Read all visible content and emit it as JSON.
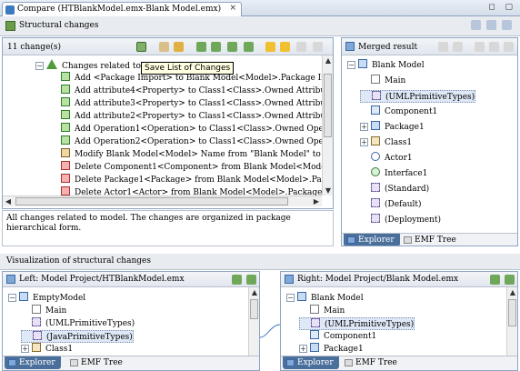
{
  "editor": {
    "tab_title": "Compare (HTBlankModel.emx-Blank Model.emx)",
    "close_glyph": "×",
    "window_glyphs": "◻ ▢"
  },
  "structural": {
    "section_title": "Structural changes",
    "count_label": "11 change(s)",
    "tooltip": "Save List of Changes",
    "rows": [
      {
        "text": "Changes related to Blank Model",
        "kind": "tri",
        "expand": "−"
      },
      {
        "text": "Add <Package Import> to Blank Model<Model>.Package Import",
        "kind": "add"
      },
      {
        "text": "Add attribute4<Property> to Class1<Class>.Owned Attribute",
        "kind": "add"
      },
      {
        "text": "Add attribute3<Property> to Class1<Class>.Owned Attribute",
        "kind": "add"
      },
      {
        "text": "Add attribute2<Property> to Class1<Class>.Owned Attribute",
        "kind": "add"
      },
      {
        "text": "Add Operation1<Operation> to Class1<Class>.Owned Operation",
        "kind": "add"
      },
      {
        "text": "Add Operation2<Operation> to Class1<Class>.Owned Operation",
        "kind": "add"
      },
      {
        "text": "Modify Blank Model<Model> Name from \"Blank Model\" to \"Em",
        "kind": "mod"
      },
      {
        "text": "Delete Component1<Component> from Blank Model<Model>.Pa",
        "kind": "del"
      },
      {
        "text": "Delete Package1<Package> from Blank Model<Model>.Packagec",
        "kind": "del"
      },
      {
        "text": "Delete Actor1<Actor> from Blank Model<Model>.Packaged Ele",
        "kind": "del"
      }
    ],
    "description": "All changes related to model. The changes are organized in package hierarchical form."
  },
  "merged": {
    "title": "Merged result",
    "tree": [
      {
        "text": "Blank Model",
        "kind": "pkg",
        "expand": "−",
        "indent": 0
      },
      {
        "text": "Main",
        "kind": "doc",
        "indent": 1
      },
      {
        "text": "(UMLPrimitiveTypes)",
        "kind": "lib",
        "indent": 1,
        "selected": true
      },
      {
        "text": "Component1",
        "kind": "comp",
        "indent": 1
      },
      {
        "text": "Package1",
        "kind": "pkg",
        "expand": "+",
        "indent": 1
      },
      {
        "text": "Class1",
        "kind": "cls",
        "expand": "+",
        "indent": 1
      },
      {
        "text": "Actor1",
        "kind": "actor",
        "indent": 1
      },
      {
        "text": "Interface1",
        "kind": "intf",
        "indent": 1
      },
      {
        "text": "(Standard)",
        "kind": "lib",
        "indent": 1
      },
      {
        "text": "(Default)",
        "kind": "lib",
        "indent": 1
      },
      {
        "text": "(Deployment)",
        "kind": "lib",
        "indent": 1
      }
    ],
    "tabs": [
      "Explorer",
      "EMF Tree"
    ]
  },
  "visualization": {
    "section_title": "Visualization of structural changes",
    "left": {
      "title": "Left: Model Project/HTBlankModel.emx",
      "tree": [
        {
          "text": "EmptyModel",
          "kind": "pkg",
          "expand": "−",
          "indent": 0
        },
        {
          "text": "Main",
          "kind": "doc",
          "indent": 1
        },
        {
          "text": "(UMLPrimitiveTypes)",
          "kind": "lib",
          "indent": 1
        },
        {
          "text": "(JavaPrimitiveTypes)",
          "kind": "lib",
          "indent": 1,
          "selected": true
        },
        {
          "text": "Class1",
          "kind": "cls",
          "expand": "+",
          "indent": 1
        }
      ],
      "tabs": [
        "Explorer",
        "EMF Tree"
      ]
    },
    "right": {
      "title": "Right: Model Project/Blank Model.emx",
      "tree": [
        {
          "text": "Blank Model",
          "kind": "pkg",
          "expand": "−",
          "indent": 0
        },
        {
          "text": "Main",
          "kind": "doc",
          "indent": 1
        },
        {
          "text": "(UMLPrimitiveTypes)",
          "kind": "lib",
          "indent": 1,
          "selected": true
        },
        {
          "text": "Component1",
          "kind": "comp",
          "indent": 1
        },
        {
          "text": "Package1",
          "kind": "pkg",
          "expand": "+",
          "indent": 1
        }
      ],
      "tabs": [
        "Explorer",
        "EMF Tree"
      ]
    }
  },
  "colors": {
    "accent": "#4b6f9b",
    "add": "#2f7d2f",
    "delete": "#a83232",
    "modify": "#7a5b2f",
    "section_bg": "#e8ebef"
  }
}
